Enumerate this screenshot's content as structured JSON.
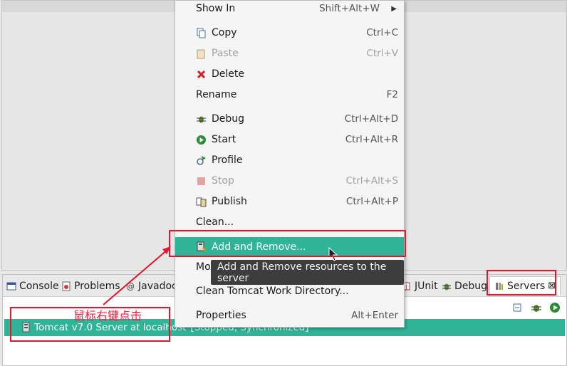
{
  "context_menu": {
    "items": [
      {
        "label": "Show In",
        "shortcut": "Shift+Alt+W",
        "submenu": true
      },
      {
        "label": "Copy",
        "shortcut": "Ctrl+C",
        "icon": "copy-icon"
      },
      {
        "label": "Paste",
        "shortcut": "Ctrl+V",
        "icon": "paste-icon",
        "disabled": true
      },
      {
        "label": "Delete",
        "shortcut": "",
        "icon": "delete-icon"
      },
      {
        "label": "Rename",
        "shortcut": "F2"
      },
      {
        "label": "Debug",
        "shortcut": "Ctrl+Alt+D",
        "icon": "debug-icon"
      },
      {
        "label": "Start",
        "shortcut": "Ctrl+Alt+R",
        "icon": "start-icon"
      },
      {
        "label": "Profile",
        "shortcut": "",
        "icon": "profile-icon"
      },
      {
        "label": "Stop",
        "shortcut": "Ctrl+Alt+S",
        "icon": "stop-icon",
        "disabled": true
      },
      {
        "label": "Publish",
        "shortcut": "Ctrl+Alt+P",
        "icon": "publish-icon"
      },
      {
        "label": "Clean...",
        "shortcut": ""
      },
      {
        "label": "Add and Remove...",
        "shortcut": "",
        "icon": "add-remove-icon",
        "highlighted": true
      },
      {
        "label": "Mo",
        "shortcut": "",
        "submenu": true
      },
      {
        "label": "Clean Tomcat Work Directory...",
        "shortcut": ""
      },
      {
        "label": "Properties",
        "shortcut": "Alt+Enter"
      }
    ]
  },
  "tooltip": {
    "text": "Add and Remove resources to the server"
  },
  "bottom_tabs": {
    "console": "Console",
    "problems": "Problems",
    "javadoc": "Javadoc",
    "junit": "JUnit",
    "debug": "Debug",
    "servers": "Servers",
    "close_glyph": "⊠"
  },
  "server": {
    "name": "Tomcat v7.0 Server at localhost",
    "status": "[Stopped, Synchronized]"
  },
  "annotation": {
    "text": "鼠标右键点击"
  },
  "colors": {
    "highlight": "#2fb498",
    "annotation": "#e6142d",
    "tooltip_bg": "#3d3d3d"
  }
}
